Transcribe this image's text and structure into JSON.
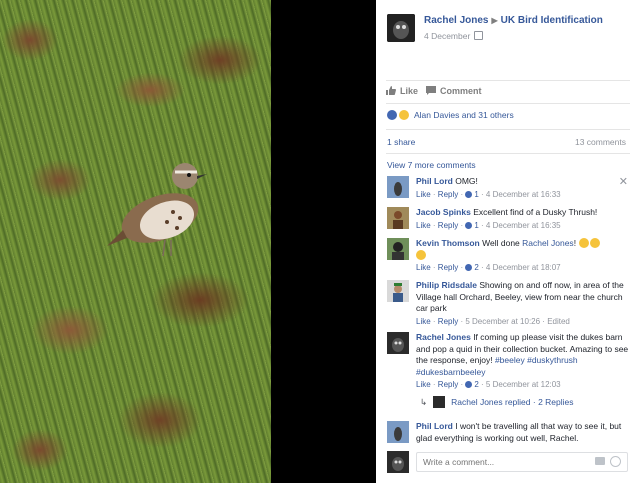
{
  "post": {
    "author": "Rachel Jones",
    "group": "UK Bird Identification",
    "date": "4 December",
    "actions": {
      "like": "Like",
      "comment": "Comment"
    },
    "reactions_text": "Alan Davies and 31 others",
    "shares": "1 share",
    "comments_count": "13 comments"
  },
  "view_more": "View 7 more comments",
  "comments": [
    {
      "name": "Phil Lord",
      "text": "OMG!",
      "like": "Like",
      "reply": "Reply",
      "likes": "1",
      "time": "4 December at 16:33"
    },
    {
      "name": "Jacob Spinks",
      "text": "Excellent find of a Dusky Thrush!",
      "like": "Like",
      "reply": "Reply",
      "likes": "1",
      "time": "4 December at 16:35"
    },
    {
      "name": "Kevin Thomson",
      "text": "Well done",
      "mention": "Rachel Jones",
      "text_after": "!",
      "like": "Like",
      "reply": "Reply",
      "likes": "2",
      "time": "4 December at 18:07"
    },
    {
      "name": "Philip Ridsdale",
      "text": "Showing on and off now, in area of the Village hall Orchard, Beeley, view from near the church car park",
      "like": "Like",
      "reply": "Reply",
      "time": "5 December at 10:26",
      "edited": "Edited"
    },
    {
      "name": "Rachel Jones",
      "text": "If coming up please visit the dukes barn and pop a quid in their collection bucket. Amazing to see the response, enjoy!",
      "tags": [
        "#beeley",
        "#duskythrush",
        "#dukesbarnbeeley"
      ],
      "like": "Like",
      "reply": "Reply",
      "likes": "2",
      "time": "5 December at 12:03"
    },
    {
      "name": "Phil Lord",
      "text": "I won't be travelling all that way to see it, but glad everything is working out well, Rachel."
    }
  ],
  "reply_summary": {
    "text": "Rachel Jones replied",
    "count": "2 Replies"
  },
  "write_comment": {
    "placeholder": "Write a comment..."
  },
  "icons": [
    "like-icon",
    "comment-icon",
    "globe-icon",
    "close-icon",
    "camera-icon",
    "emoji-icon",
    "reply-arrow-icon"
  ],
  "colors": {
    "link": "#365899",
    "meta": "#90949c",
    "like_blue": "#4267b2"
  }
}
